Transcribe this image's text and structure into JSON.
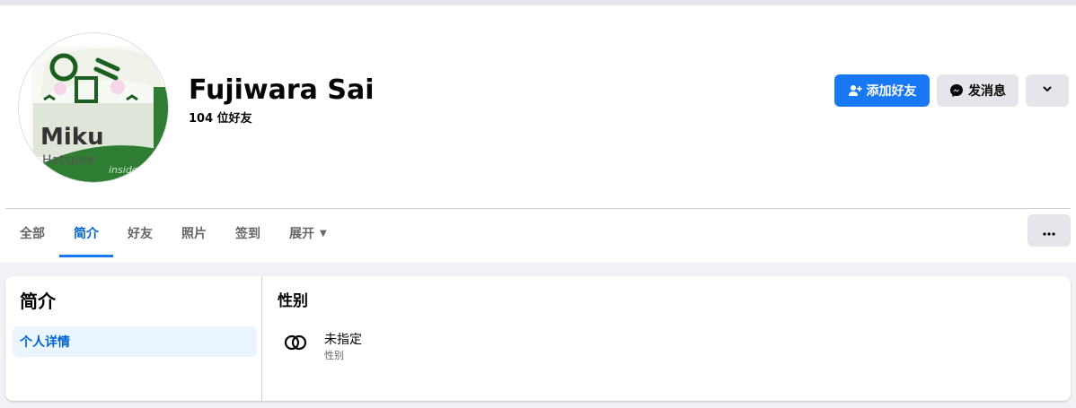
{
  "profile": {
    "name": "Fujiwara Sai",
    "friends_count": "104 位好友",
    "avatar": {
      "icon": "miku-hatsune-avatar",
      "text_main": "Miku",
      "text_sub": "Hatsune",
      "text_corner": "inside"
    }
  },
  "actions": {
    "add_friend_label": "添加好友",
    "message_label": "发消息",
    "more_icon": "chevron-down-icon"
  },
  "tabs": [
    {
      "label": "全部",
      "active": false
    },
    {
      "label": "简介",
      "active": true
    },
    {
      "label": "好友",
      "active": false
    },
    {
      "label": "照片",
      "active": false
    },
    {
      "label": "签到",
      "active": false
    },
    {
      "label": "展开",
      "active": false
    }
  ],
  "tabs_menu_icon": "more-dots-icon",
  "about": {
    "sidebar_title": "简介",
    "sidebar_items": [
      {
        "label": "个人详情",
        "active": true
      }
    ],
    "section_title": "性别",
    "gender_value": "未指定",
    "gender_label": "性别"
  },
  "colors": {
    "accent": "#1877f2",
    "active_tab_text": "#0064d1",
    "button_gray": "#e4e6eb",
    "page_bg": "#f0f2f5",
    "avatar_green": "#2e7d32"
  }
}
